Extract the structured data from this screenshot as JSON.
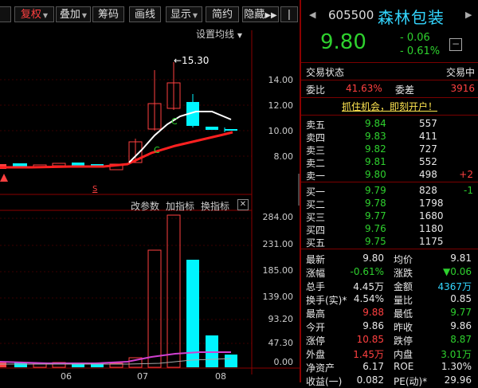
{
  "toolbar": {
    "buttons": [
      {
        "label": "复权",
        "has_dropdown": true,
        "active": true
      },
      {
        "label": "叠加",
        "has_dropdown": true
      },
      {
        "label": "筹码"
      },
      {
        "label": "画线"
      },
      {
        "label": "显示",
        "has_dropdown": true
      },
      {
        "label": "简约"
      },
      {
        "label": "隐藏"
      }
    ],
    "more_icon": "double-chevron-right-icon",
    "setting_ma": "设置均线",
    "setting_ma_icon": "caret-down-icon"
  },
  "price_chart": {
    "peak_label": "←15.30",
    "axis_labels": [
      "14.00",
      "12.00",
      "10.00",
      "8.00"
    ],
    "marker_c1": "C",
    "marker_c2": "C",
    "marker_s": "S"
  },
  "indicator_bar": {
    "change_params": "改参数",
    "add_indicator": "加指标",
    "switch_indicator": "换指标",
    "close_icon": "close-icon"
  },
  "volume_chart": {
    "axis_labels": [
      "284.00",
      "231.00",
      "185.00",
      "139.00",
      "93.20",
      "47.30",
      "0.00"
    ]
  },
  "date_axis": [
    "06",
    "07",
    "08"
  ],
  "quote": {
    "code": "605500",
    "name": "森林包装",
    "price": "9.80",
    "change": "- 0.06",
    "change_pct": "- 0.61%",
    "trade_status_label": "交易状态",
    "trade_status_value": "交易中",
    "weibi_label": "委比",
    "weibi_value": "41.63%",
    "weicha_label": "委差",
    "weicha_value": "3916",
    "promo": "抓住机会，即刻开户！",
    "sell": [
      {
        "label": "卖五",
        "price": "9.84",
        "vol": "557",
        "delta": ""
      },
      {
        "label": "卖四",
        "price": "9.83",
        "vol": "411",
        "delta": ""
      },
      {
        "label": "卖三",
        "price": "9.82",
        "vol": "727",
        "delta": ""
      },
      {
        "label": "卖二",
        "price": "9.81",
        "vol": "552",
        "delta": ""
      },
      {
        "label": "卖一",
        "price": "9.80",
        "vol": "498",
        "delta": "+2"
      }
    ],
    "buy": [
      {
        "label": "买一",
        "price": "9.79",
        "vol": "828",
        "delta": "-1"
      },
      {
        "label": "买二",
        "price": "9.78",
        "vol": "1798",
        "delta": ""
      },
      {
        "label": "买三",
        "price": "9.77",
        "vol": "1680",
        "delta": ""
      },
      {
        "label": "买四",
        "price": "9.76",
        "vol": "1180",
        "delta": ""
      },
      {
        "label": "买五",
        "price": "9.75",
        "vol": "1175",
        "delta": ""
      }
    ],
    "stats": [
      {
        "l1": "最新",
        "v1": "9.80",
        "c1": "white",
        "l2": "均价",
        "v2": "9.81",
        "c2": "white"
      },
      {
        "l1": "涨幅",
        "v1": "-0.61%",
        "c1": "green",
        "l2": "涨跌",
        "v2": "▼0.06",
        "c2": "green"
      },
      {
        "l1": "总手",
        "v1": "4.45万",
        "c1": "white",
        "l2": "金额",
        "v2": "4367万",
        "c2": "cyan"
      },
      {
        "l1": "换手(实)*",
        "v1": "4.54%",
        "c1": "white",
        "l2": "量比",
        "v2": "0.85",
        "c2": "white"
      },
      {
        "l1": "最高",
        "v1": "9.88",
        "c1": "red",
        "l2": "最低",
        "v2": "9.77",
        "c2": "green"
      },
      {
        "l1": "今开",
        "v1": "9.86",
        "c1": "white",
        "l2": "昨收",
        "v2": "9.86",
        "c2": "white"
      },
      {
        "l1": "涨停",
        "v1": "10.85",
        "c1": "red",
        "l2": "跌停",
        "v2": "8.87",
        "c2": "green"
      },
      {
        "l1": "外盘",
        "v1": "1.45万",
        "c1": "red",
        "l2": "内盘",
        "v2": "3.01万",
        "c2": "green"
      },
      {
        "l1": "净资产",
        "v1": "6.17",
        "c1": "white",
        "l2": "ROE",
        "v2": "1.30%",
        "c2": "white"
      },
      {
        "l1": "收益(一)",
        "v1": "0.082",
        "c1": "white",
        "l2": "PE(动)*",
        "v2": "29.96",
        "c2": "white"
      }
    ]
  },
  "colors": {
    "up": "#ff4040",
    "down": "#2ed12e",
    "accent": "#33d6ff",
    "volume_down": "#00f5ff"
  }
}
